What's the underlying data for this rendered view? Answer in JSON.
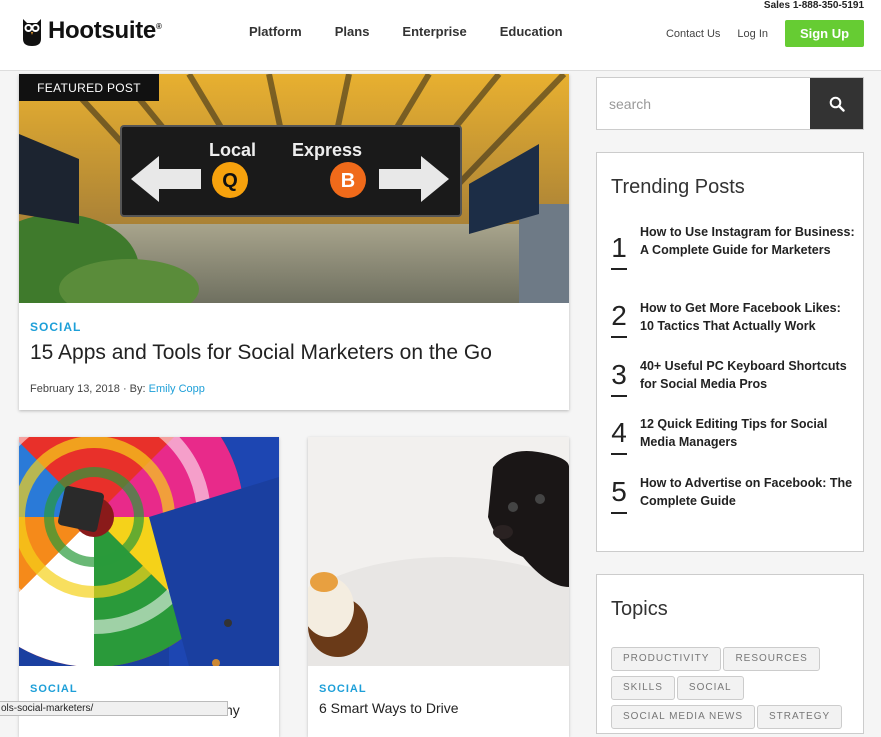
{
  "header": {
    "sales": "Sales 1-888-350-5191",
    "logo": "Hootsuite",
    "logo_mark": "®",
    "nav": [
      "Platform",
      "Plans",
      "Enterprise",
      "Education"
    ],
    "contact": "Contact Us",
    "login": "Log In",
    "signup": "Sign Up"
  },
  "featured": {
    "badge": "FEATURED POST",
    "category": "SOCIAL",
    "title": "15 Apps and Tools for Social Marketers on the Go",
    "date": "February 13, 2018 · By: ",
    "author": "Emily Copp",
    "sign_local": "Local",
    "sign_express": "Express",
    "sign_q": "Q",
    "sign_b": "B"
  },
  "cards": [
    {
      "category": "SOCIAL",
      "title": "ny"
    },
    {
      "category": "SOCIAL",
      "title": "6 Smart Ways to Drive"
    }
  ],
  "search": {
    "placeholder": "search"
  },
  "trending": {
    "title": "Trending Posts",
    "items": [
      {
        "num": "1",
        "text": "How to Use Instagram for Business: A Complete Guide for Marketers"
      },
      {
        "num": "2",
        "text": "How to Get More Facebook Likes: 10 Tactics That Actually Work"
      },
      {
        "num": "3",
        "text": "40+ Useful PC Keyboard Shortcuts for Social Media Pros"
      },
      {
        "num": "4",
        "text": "12 Quick Editing Tips for Social Media Managers"
      },
      {
        "num": "5",
        "text": "How to Advertise on Facebook: The Complete Guide"
      }
    ]
  },
  "topics": {
    "title": "Topics",
    "tags": [
      "PRODUCTIVITY",
      "RESOURCES",
      "SKILLS",
      "SOCIAL",
      "SOCIAL MEDIA NEWS",
      "STRATEGY"
    ]
  },
  "status_url": "ols-social-marketers/",
  "colors": {
    "accent": "#1d9fd8",
    "signup": "#66cc33",
    "dark": "#333333"
  }
}
